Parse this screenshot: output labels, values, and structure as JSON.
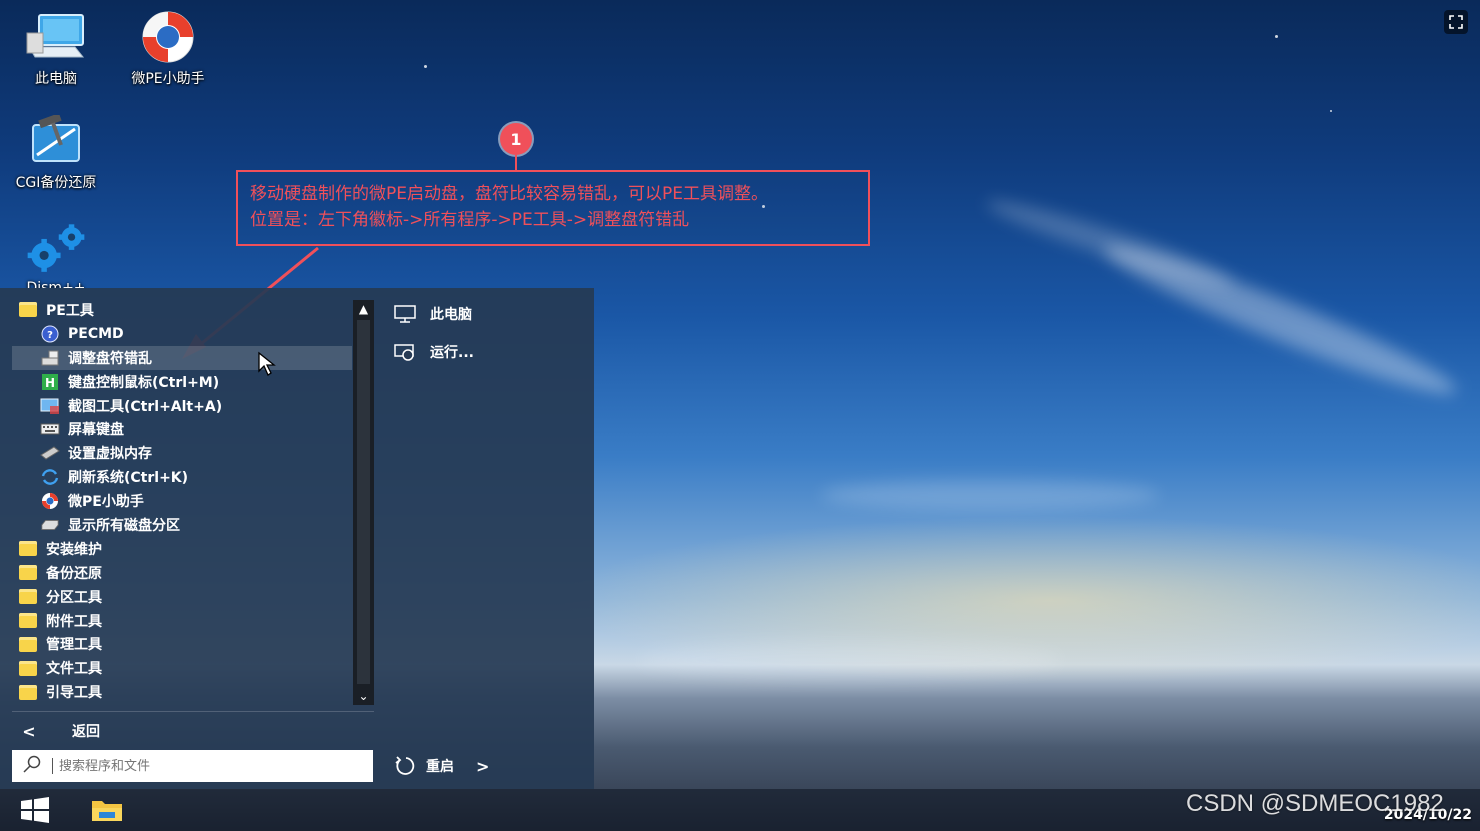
{
  "desktop": {
    "icons": [
      {
        "label": "此电脑",
        "icon": "computer-icon"
      },
      {
        "label": "微PE小助手",
        "icon": "lifebuoy-icon"
      },
      {
        "label": "CGI备份还原",
        "icon": "cgi-backup-icon"
      },
      {
        "label": "Dism++",
        "icon": "gears-icon"
      }
    ]
  },
  "annotation": {
    "number": "1",
    "line1": "移动硬盘制作的微PE启动盘，盘符比较容易错乱，可以PE工具调整。",
    "line2": "位置是：左下角徽标->所有程序->PE工具->调整盘符错乱",
    "color": "#f0505a"
  },
  "start_menu": {
    "items": [
      {
        "label": "PE工具",
        "level": "top",
        "icon": "folder-icon"
      },
      {
        "label": "PECMD",
        "level": "sub",
        "icon": "pecmd-icon"
      },
      {
        "label": "调整盘符错乱",
        "level": "sub",
        "icon": "drive-letter-icon",
        "highlighted": true
      },
      {
        "label": "键盘控制鼠标(Ctrl+M)",
        "level": "sub",
        "icon": "keyboard-mouse-icon"
      },
      {
        "label": "截图工具(Ctrl+Alt+A)",
        "level": "sub",
        "icon": "screenshot-icon"
      },
      {
        "label": "屏幕键盘",
        "level": "sub",
        "icon": "onscreen-keyboard-icon"
      },
      {
        "label": "设置虚拟内存",
        "level": "sub",
        "icon": "memory-icon"
      },
      {
        "label": "刷新系统(Ctrl+K)",
        "level": "sub",
        "icon": "refresh-icon"
      },
      {
        "label": "微PE小助手",
        "level": "sub",
        "icon": "lifebuoy-icon"
      },
      {
        "label": "显示所有磁盘分区",
        "level": "sub",
        "icon": "disk-icon"
      },
      {
        "label": "安装维护",
        "level": "top",
        "icon": "folder-icon"
      },
      {
        "label": "备份还原",
        "level": "top",
        "icon": "folder-icon"
      },
      {
        "label": "分区工具",
        "level": "top",
        "icon": "folder-icon"
      },
      {
        "label": "附件工具",
        "level": "top",
        "icon": "folder-icon"
      },
      {
        "label": "管理工具",
        "level": "top",
        "icon": "folder-icon"
      },
      {
        "label": "文件工具",
        "level": "top",
        "icon": "folder-icon"
      },
      {
        "label": "引导工具",
        "level": "top",
        "icon": "folder-icon"
      }
    ],
    "back_label": "返回",
    "search_placeholder": "搜索程序和文件",
    "right_items": [
      {
        "label": "此电脑",
        "icon": "monitor-icon"
      },
      {
        "label": "运行...",
        "icon": "run-icon"
      }
    ],
    "restart_label": "重启"
  },
  "taskbar": {
    "date": "2024/10/22"
  },
  "watermark": "CSDN @SDMEOC1982"
}
